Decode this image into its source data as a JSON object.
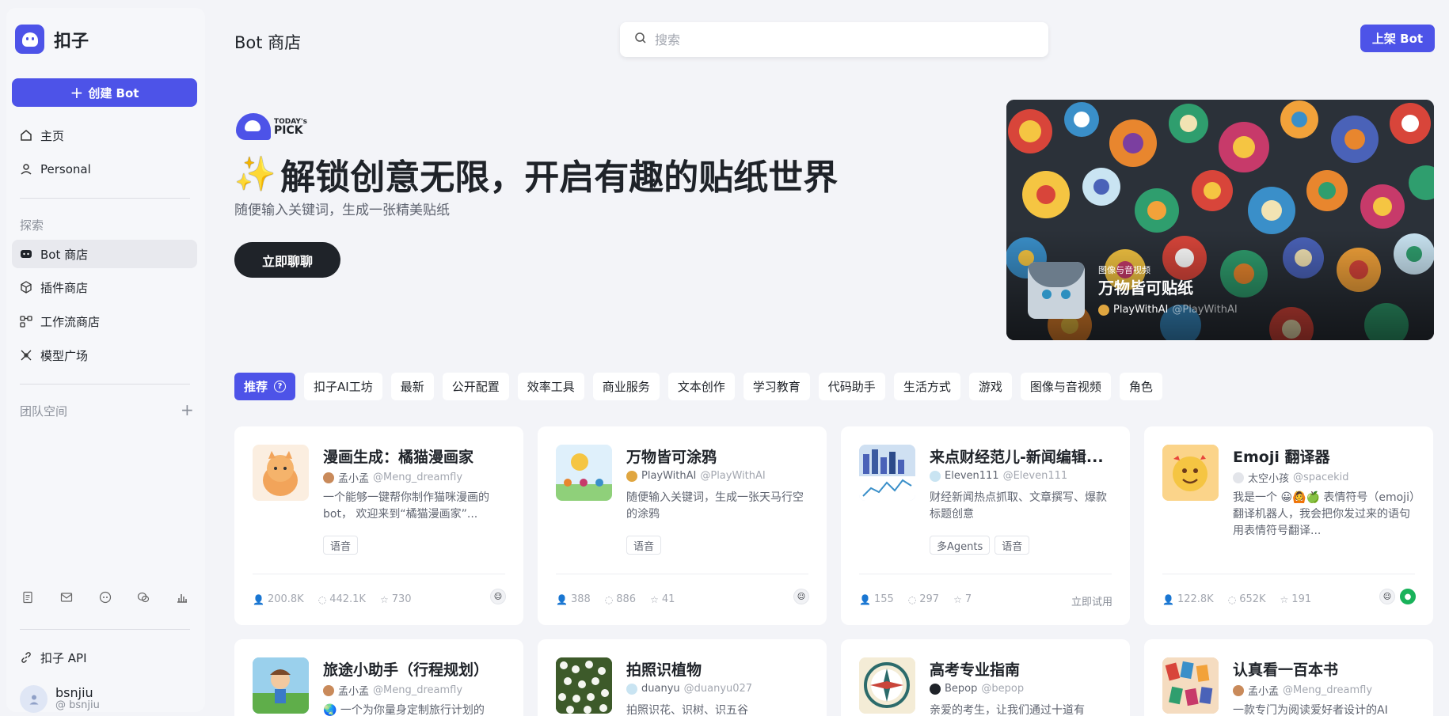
{
  "brand": {
    "name": "扣子"
  },
  "sidebar": {
    "create_label": "创建 Bot",
    "nav_top": [
      {
        "label": "主页",
        "icon": "home-icon"
      },
      {
        "label": "Personal",
        "icon": "person-icon"
      }
    ],
    "explore_label": "探索",
    "nav_explore": [
      {
        "label": "Bot 商店",
        "icon": "bot-icon"
      },
      {
        "label": "插件商店",
        "icon": "cube-icon"
      },
      {
        "label": "工作流商店",
        "icon": "workflow-icon"
      },
      {
        "label": "模型广场",
        "icon": "model-icon"
      }
    ],
    "team_label": "团队空间",
    "api_label": "扣子 API",
    "user": {
      "name": "bsnjiu",
      "handle": "@ bsnjiu"
    }
  },
  "header": {
    "title": "Bot 商店",
    "search_placeholder": "搜索",
    "publish_label": "上架 Bot"
  },
  "hero": {
    "pick_small": "TODAY's",
    "pick_big": "PICK",
    "title": "解锁创意无限，开启有趣的贴纸世界",
    "subtitle": "随便输入关键词，生成一张精美贴纸",
    "cta": "立即聊聊",
    "banner": {
      "category": "图像与音视频",
      "name": "万物皆可贴纸",
      "author": "PlayWithAI",
      "handle": "@PlayWithAI"
    }
  },
  "tabs": [
    "推荐",
    "扣子AI工坊",
    "最新",
    "公开配置",
    "效率工具",
    "商业服务",
    "文本创作",
    "学习教育",
    "代码助手",
    "生活方式",
    "游戏",
    "图像与音视频",
    "角色"
  ],
  "cards": [
    {
      "title": "漫画生成：橘猫漫画家",
      "author": "孟小孟",
      "handle": "@Meng_dreamfly",
      "desc": "一个能够一键帮你制作猫咪漫画的bot， 欢迎来到“橘猫漫画家”...",
      "tags": [
        "语音"
      ],
      "users": "200.8K",
      "chats": "442.1K",
      "stars": "730",
      "try": ""
    },
    {
      "title": "万物皆可涂鸦",
      "author": "PlayWithAI",
      "handle": "@PlayWithAI",
      "desc": "随便输入关键词，生成一张天马行空的涂鸦",
      "tags": [
        "语音"
      ],
      "users": "388",
      "chats": "886",
      "stars": "41",
      "try": ""
    },
    {
      "title": "来点财经范儿-新闻编辑...",
      "author": "Eleven111",
      "handle": "@Eleven111",
      "desc": "财经新闻热点抓取、文章撰写、爆款标题创意",
      "tags": [
        "多Agents",
        "语音"
      ],
      "users": "155",
      "chats": "297",
      "stars": "7",
      "try": "立即试用"
    },
    {
      "title": "Emoji 翻译器",
      "author": "太空小孩",
      "handle": "@spacekid",
      "desc": "我是一个 😀🙆🍏 表情符号（emoji）翻译机器人，我会把你发过来的语句用表情符号翻译...",
      "tags": [],
      "users": "122.8K",
      "chats": "652K",
      "stars": "191",
      "try": ""
    },
    {
      "title": "旅途小助手（行程规划）",
      "author": "孟小孟",
      "handle": "@Meng_dreamfly",
      "desc": "一个为你量身定制旅行计划的",
      "tags": [],
      "users": "",
      "chats": "",
      "stars": "",
      "try": ""
    },
    {
      "title": "拍照识植物",
      "author": "duanyu",
      "handle": "@duanyu027",
      "desc": "拍照识花、识树、识五谷",
      "tags": [],
      "users": "",
      "chats": "",
      "stars": "",
      "try": ""
    },
    {
      "title": "高考专业指南",
      "author": "Bepop",
      "handle": "@bepop",
      "desc": "亲爱的考生，让我们通过十道有",
      "tags": [],
      "users": "",
      "chats": "",
      "stars": "",
      "try": ""
    },
    {
      "title": "认真看一百本书",
      "author": "孟小孟",
      "handle": "@Meng_dreamfly",
      "desc": "一款专门为阅读爱好者设计的AI",
      "tags": [],
      "users": "",
      "chats": "",
      "stars": "",
      "try": ""
    }
  ],
  "colors": {
    "accent": "#4d53e8",
    "dark": "#1f2329"
  }
}
